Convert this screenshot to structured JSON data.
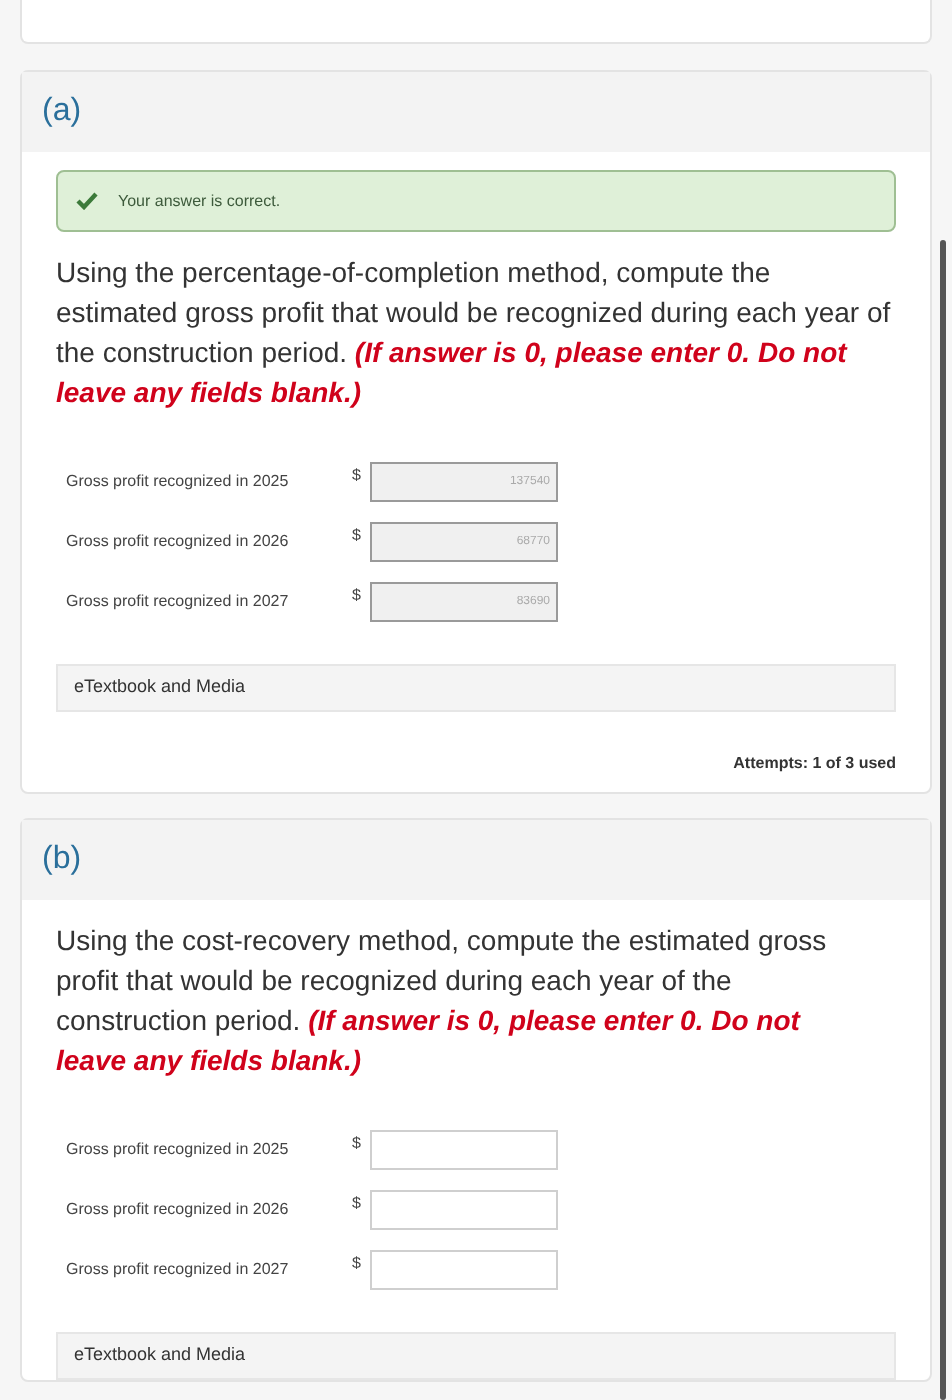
{
  "parts": [
    {
      "label": "(a)",
      "feedback": "Your answer is correct.",
      "question": "Using the percentage-of-completion method, compute the estimated gross profit that would be recognized during each year of the construction period.",
      "instruction": "(If answer is 0, please enter 0. Do not leave any fields blank.)",
      "rows": [
        {
          "label": "Gross profit recognized in 2025",
          "currency": "$",
          "value": "137540",
          "disabled": true
        },
        {
          "label": "Gross profit recognized in 2026",
          "currency": "$",
          "value": "68770",
          "disabled": true
        },
        {
          "label": "Gross profit recognized in 2027",
          "currency": "$",
          "value": "83690",
          "disabled": true
        }
      ],
      "resources": "eTextbook and Media",
      "attempts": "Attempts: 1 of 3 used"
    },
    {
      "label": "(b)",
      "question": "Using the cost-recovery method, compute the estimated gross profit that would be recognized during each year of the construction period.",
      "instruction": "(If answer is 0, please enter 0. Do not leave any fields blank.)",
      "rows": [
        {
          "label": "Gross profit recognized in 2025",
          "currency": "$",
          "disabled": false
        },
        {
          "label": "Gross profit recognized in 2026",
          "currency": "$",
          "disabled": false
        },
        {
          "label": "Gross profit recognized in 2027",
          "currency": "$",
          "disabled": false
        }
      ],
      "resources": "eTextbook and Media"
    }
  ]
}
